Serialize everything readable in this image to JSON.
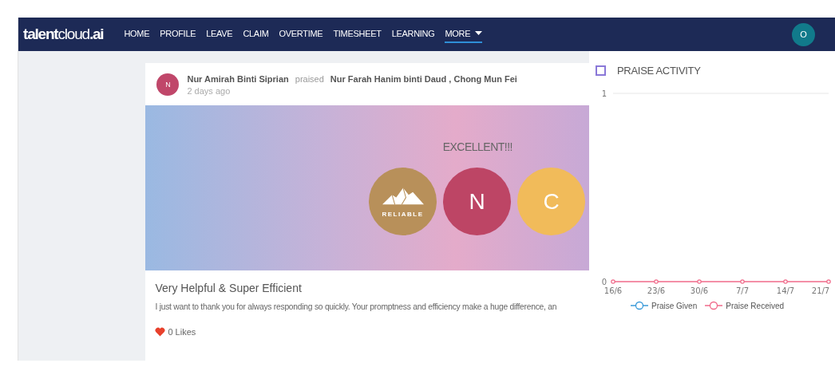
{
  "navbar": {
    "logo": {
      "bold_start": "talent",
      "light": "cloud",
      "bold_end": ".ai"
    },
    "items": [
      {
        "label": "HOME",
        "selected": false
      },
      {
        "label": "PROFILE",
        "selected": false
      },
      {
        "label": "LEAVE",
        "selected": false
      },
      {
        "label": "CLAIM",
        "selected": false
      },
      {
        "label": "OVERTIME",
        "selected": false
      },
      {
        "label": "TIMESHEET",
        "selected": false
      },
      {
        "label": "LEARNING",
        "selected": false
      },
      {
        "label": "MORE",
        "selected": true,
        "dropdown": true
      }
    ],
    "user_avatar": "O"
  },
  "post": {
    "author_avatar": "N",
    "author": "Nur Amirah Binti Siprian",
    "verb": "praised",
    "recipients": "Nur Farah Hanim binti Daud , Chong Mun Fei",
    "time": "2 days ago",
    "banner": {
      "heading": "EXCELLENT!!!",
      "badges": [
        {
          "kind": "award",
          "label": "RELIABLE",
          "color": "#b8905a"
        },
        {
          "kind": "initial",
          "label": "N",
          "color": "#bd4565"
        },
        {
          "kind": "initial",
          "label": "C",
          "color": "#f1bb5a"
        }
      ]
    },
    "title": "Very Helpful & Super Efficient",
    "message": "I just want to thank you for always responding so quickly. Your promptness and efficiency make a huge difference, an",
    "likes": "0 Likes"
  },
  "activity": {
    "title": "PRAISE ACTIVITY",
    "chart_data": {
      "type": "line",
      "categories": [
        "16/6",
        "23/6",
        "30/6",
        "7/7",
        "14/7",
        "21/7"
      ],
      "ylim": [
        0,
        1
      ],
      "yticks": [
        0,
        1
      ],
      "series": [
        {
          "name": "Praise Given",
          "color": "#3a9ad9",
          "marker": "circle",
          "values": [
            null,
            null,
            null,
            null,
            null,
            null
          ]
        },
        {
          "name": "Praise Received",
          "color": "#f06a8a",
          "marker": "circle",
          "values": [
            0,
            0,
            0,
            0,
            0,
            0
          ]
        }
      ]
    }
  }
}
